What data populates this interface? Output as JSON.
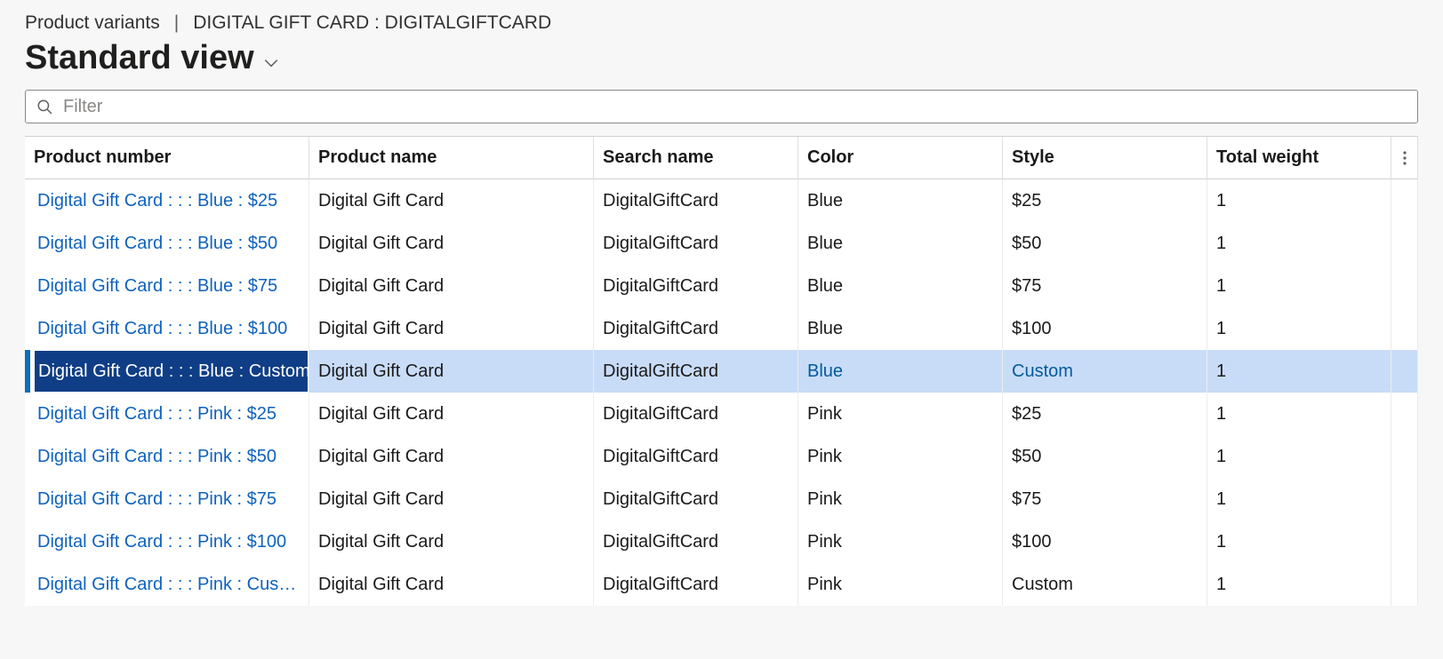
{
  "breadcrumb": {
    "root": "Product variants",
    "context": "DIGITAL GIFT CARD : DIGITALGIFTCARD"
  },
  "view_title": "Standard view",
  "filter": {
    "placeholder": "Filter",
    "value": ""
  },
  "columns": {
    "product_number": "Product number",
    "product_name": "Product name",
    "search_name": "Search name",
    "color": "Color",
    "style": "Style",
    "total_weight": "Total weight"
  },
  "rows": [
    {
      "pnum": "Digital Gift Card :  :  : Blue : $25",
      "pname": "Digital Gift Card",
      "sname": "DigitalGiftCard",
      "color": "Blue",
      "style": "$25",
      "weight": "1",
      "selected": false
    },
    {
      "pnum": "Digital Gift Card :  :  : Blue : $50",
      "pname": "Digital Gift Card",
      "sname": "DigitalGiftCard",
      "color": "Blue",
      "style": "$50",
      "weight": "1",
      "selected": false
    },
    {
      "pnum": "Digital Gift Card :  :  : Blue : $75",
      "pname": "Digital Gift Card",
      "sname": "DigitalGiftCard",
      "color": "Blue",
      "style": "$75",
      "weight": "1",
      "selected": false
    },
    {
      "pnum": "Digital Gift Card :  :  : Blue : $100",
      "pname": "Digital Gift Card",
      "sname": "DigitalGiftCard",
      "color": "Blue",
      "style": "$100",
      "weight": "1",
      "selected": false
    },
    {
      "pnum": "Digital Gift Card :  :  : Blue : Custom",
      "pname": "Digital Gift Card",
      "sname": "DigitalGiftCard",
      "color": "Blue",
      "style": "Custom",
      "weight": "1",
      "selected": true
    },
    {
      "pnum": "Digital Gift Card :  :  : Pink : $25",
      "pname": "Digital Gift Card",
      "sname": "DigitalGiftCard",
      "color": "Pink",
      "style": "$25",
      "weight": "1",
      "selected": false
    },
    {
      "pnum": "Digital Gift Card :  :  : Pink : $50",
      "pname": "Digital Gift Card",
      "sname": "DigitalGiftCard",
      "color": "Pink",
      "style": "$50",
      "weight": "1",
      "selected": false
    },
    {
      "pnum": "Digital Gift Card :  :  : Pink : $75",
      "pname": "Digital Gift Card",
      "sname": "DigitalGiftCard",
      "color": "Pink",
      "style": "$75",
      "weight": "1",
      "selected": false
    },
    {
      "pnum": "Digital Gift Card :  :  : Pink : $100",
      "pname": "Digital Gift Card",
      "sname": "DigitalGiftCard",
      "color": "Pink",
      "style": "$100",
      "weight": "1",
      "selected": false
    },
    {
      "pnum": "Digital Gift Card :  :  : Pink : Custom",
      "pname": "Digital Gift Card",
      "sname": "DigitalGiftCard",
      "color": "Pink",
      "style": "Custom",
      "weight": "1",
      "selected": false
    }
  ]
}
